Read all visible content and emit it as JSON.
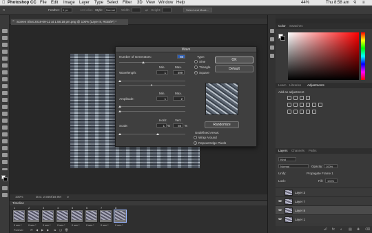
{
  "menubar": {
    "app": "Photoshop CC",
    "items": [
      "File",
      "Edit",
      "Image",
      "Layer",
      "Type",
      "Select",
      "Filter",
      "3D",
      "View",
      "Window",
      "Help"
    ],
    "center_title": "Adobe Photoshop CC 2018",
    "battery": "44%",
    "clock": "Thu 8:58 am"
  },
  "options": {
    "feather_label": "Feather:",
    "feather_value": "0 px",
    "antialias": "Anti-alias",
    "style_label": "Style:",
    "style_value": "Normal",
    "width_label": "Width:",
    "height_label": "Height:",
    "select_mask": "Select and Mask..."
  },
  "document": {
    "tab_title": "Screen Shot 2018-09-12 at 1.58.18 pm.png @ 100% (Layer 8, RGB/8*) *",
    "zoom": "100%",
    "doc_info": "Doc: 2.56M/18.9M"
  },
  "timeline": {
    "title": "Timeline",
    "frames": [
      {
        "n": "1",
        "d": "0 sec.*"
      },
      {
        "n": "2",
        "d": "0 sec.*"
      },
      {
        "n": "3",
        "d": "0 sec.*"
      },
      {
        "n": "4",
        "d": "0 sec.*"
      },
      {
        "n": "5",
        "d": "0 sec.*"
      },
      {
        "n": "6",
        "d": "0 sec.*"
      },
      {
        "n": "7",
        "d": "0 sec.*"
      },
      {
        "n": "8",
        "d": "0 sec.*"
      }
    ],
    "loop": "Forever"
  },
  "dialog": {
    "title": "Wave",
    "generators_label": "Number of Generators:",
    "generators_value": "60",
    "type_label": "Type:",
    "type_options": [
      "Sine",
      "Triangle",
      "Square"
    ],
    "type_selected": "Square",
    "min_label": "Min.",
    "max_label": "Max.",
    "wavelength_label": "Wavelength:",
    "wavelength_min": "1",
    "wavelength_max": "499",
    "amplitude_label": "Amplitude:",
    "amplitude_min": "1",
    "amplitude_max": "2",
    "horiz_label": "Horiz.",
    "vert_label": "Vert.",
    "scale_label": "Scale:",
    "scale_h": "1",
    "scale_v": "56",
    "pct": "%",
    "ok": "OK",
    "default": "Default",
    "randomize": "Randomize",
    "undefined_label": "Undefined Areas:",
    "undefined_options": [
      "Wrap Around",
      "Repeat Edge Pixels"
    ],
    "undefined_selected": "Repeat Edge Pixels"
  },
  "color_panel": {
    "tabs": [
      "Color",
      "Swatches"
    ],
    "active": "Color"
  },
  "adjustments_panel": {
    "tabs": [
      "Learn",
      "Libraries",
      "Adjustments"
    ],
    "active": "Adjustments",
    "add_label": "Add an adjustment"
  },
  "layers_panel": {
    "tabs": [
      "Layers",
      "Channels",
      "Paths"
    ],
    "active": "Layers",
    "kind": "Kind",
    "blend": "Normal",
    "opacity_label": "Opacity:",
    "opacity": "100%",
    "unify_label": "Unify:",
    "propagate": "Propagate Frame 1",
    "lock_label": "Lock:",
    "fill_label": "Fill:",
    "fill": "100%",
    "layers": [
      {
        "name": "Layer 3",
        "visible": false,
        "selected": false
      },
      {
        "name": "Layer 7",
        "visible": true,
        "selected": false
      },
      {
        "name": "Layer 8",
        "visible": true,
        "selected": true
      },
      {
        "name": "Layer 1",
        "visible": true,
        "selected": false
      }
    ]
  }
}
